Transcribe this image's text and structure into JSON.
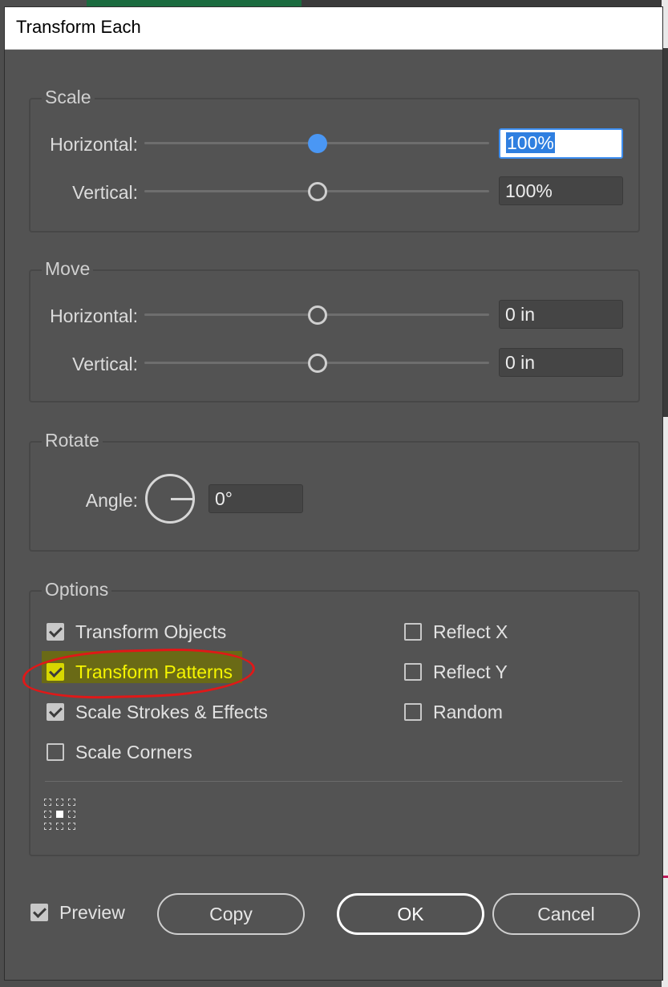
{
  "dialog": {
    "title": "Transform Each"
  },
  "scale": {
    "label": "Scale",
    "horizontal": {
      "label": "Horizontal:",
      "value": "100%",
      "slider_position": 0.5
    },
    "vertical": {
      "label": "Vertical:",
      "value": "100%",
      "slider_position": 0.5
    }
  },
  "move": {
    "label": "Move",
    "horizontal": {
      "label": "Horizontal:",
      "value": "0 in",
      "slider_position": 0.5
    },
    "vertical": {
      "label": "Vertical:",
      "value": "0 in",
      "slider_position": 0.5
    }
  },
  "rotate": {
    "label": "Rotate",
    "angle": {
      "label": "Angle:",
      "value": "0°"
    }
  },
  "options": {
    "label": "Options",
    "transform_objects": {
      "label": "Transform Objects",
      "checked": true
    },
    "transform_patterns": {
      "label": "Transform Patterns",
      "checked": true
    },
    "scale_strokes": {
      "label": "Scale Strokes & Effects",
      "checked": true
    },
    "scale_corners": {
      "label": "Scale Corners",
      "checked": false
    },
    "reflect_x": {
      "label": "Reflect X",
      "checked": false
    },
    "reflect_y": {
      "label": "Reflect Y",
      "checked": false
    },
    "random": {
      "label": "Random",
      "checked": false
    }
  },
  "footer": {
    "preview": {
      "label": "Preview",
      "checked": true
    },
    "copy_label": "Copy",
    "ok_label": "OK",
    "cancel_label": "Cancel"
  },
  "colors": {
    "dialog_bg": "#535353",
    "accent": "#4a97f4",
    "highlight": "#d7d700",
    "annotation": "#e01818"
  }
}
